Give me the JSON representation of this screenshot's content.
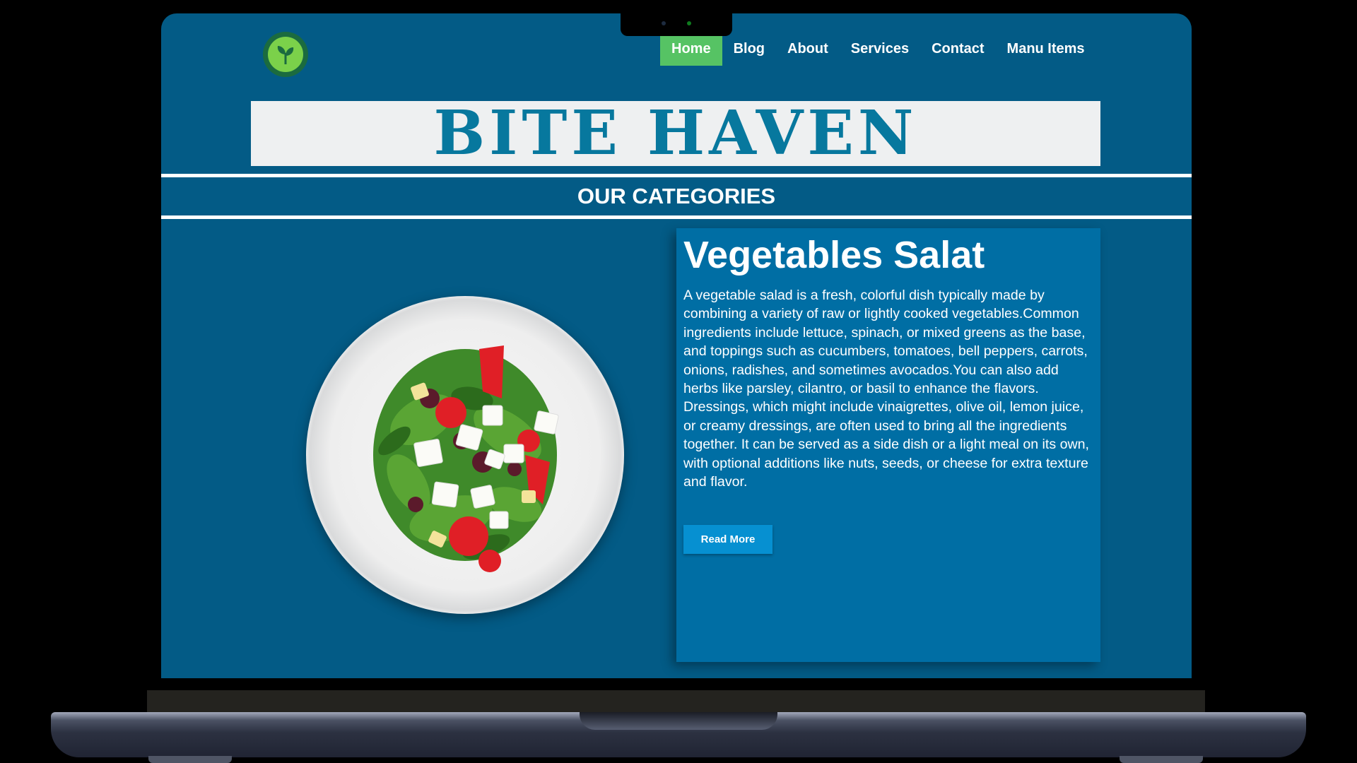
{
  "site": {
    "brand_title": "BITE HAVEN",
    "logo_icon": "leaf-logo-icon"
  },
  "nav": {
    "items": [
      {
        "label": "Home",
        "active": true
      },
      {
        "label": "Blog",
        "active": false
      },
      {
        "label": "About",
        "active": false
      },
      {
        "label": "Services",
        "active": false
      },
      {
        "label": "Contact",
        "active": false
      },
      {
        "label": "Manu Items",
        "active": false
      }
    ],
    "active_color": "#56c364"
  },
  "categories": {
    "heading": "OUR CATEGORIES"
  },
  "featured": {
    "title": "Vegetables Salat",
    "description": "A vegetable salad is a fresh, colorful dish typically made by combining a variety of raw or lightly cooked vegetables.Common ingredients include lettuce, spinach, or mixed greens as the base, and toppings such as cucumbers, tomatoes, bell peppers, carrots, onions, radishes, and sometimes avocados.You can also add herbs like parsley, cilantro, or basil to enhance the flavors. Dressings, which might include vinaigrettes, olive oil, lemon juice, or creamy dressings, are often used to bring all the ingredients together. It can be served as a side dish or a light meal on its own, with optional additions like nuts, seeds, or cheese for extra texture and flavor.",
    "button_label": "Read More"
  },
  "colors": {
    "page_background": "#035b86",
    "card_background": "#006ea4",
    "title_color": "#07789e",
    "button_color": "#0690d1"
  }
}
